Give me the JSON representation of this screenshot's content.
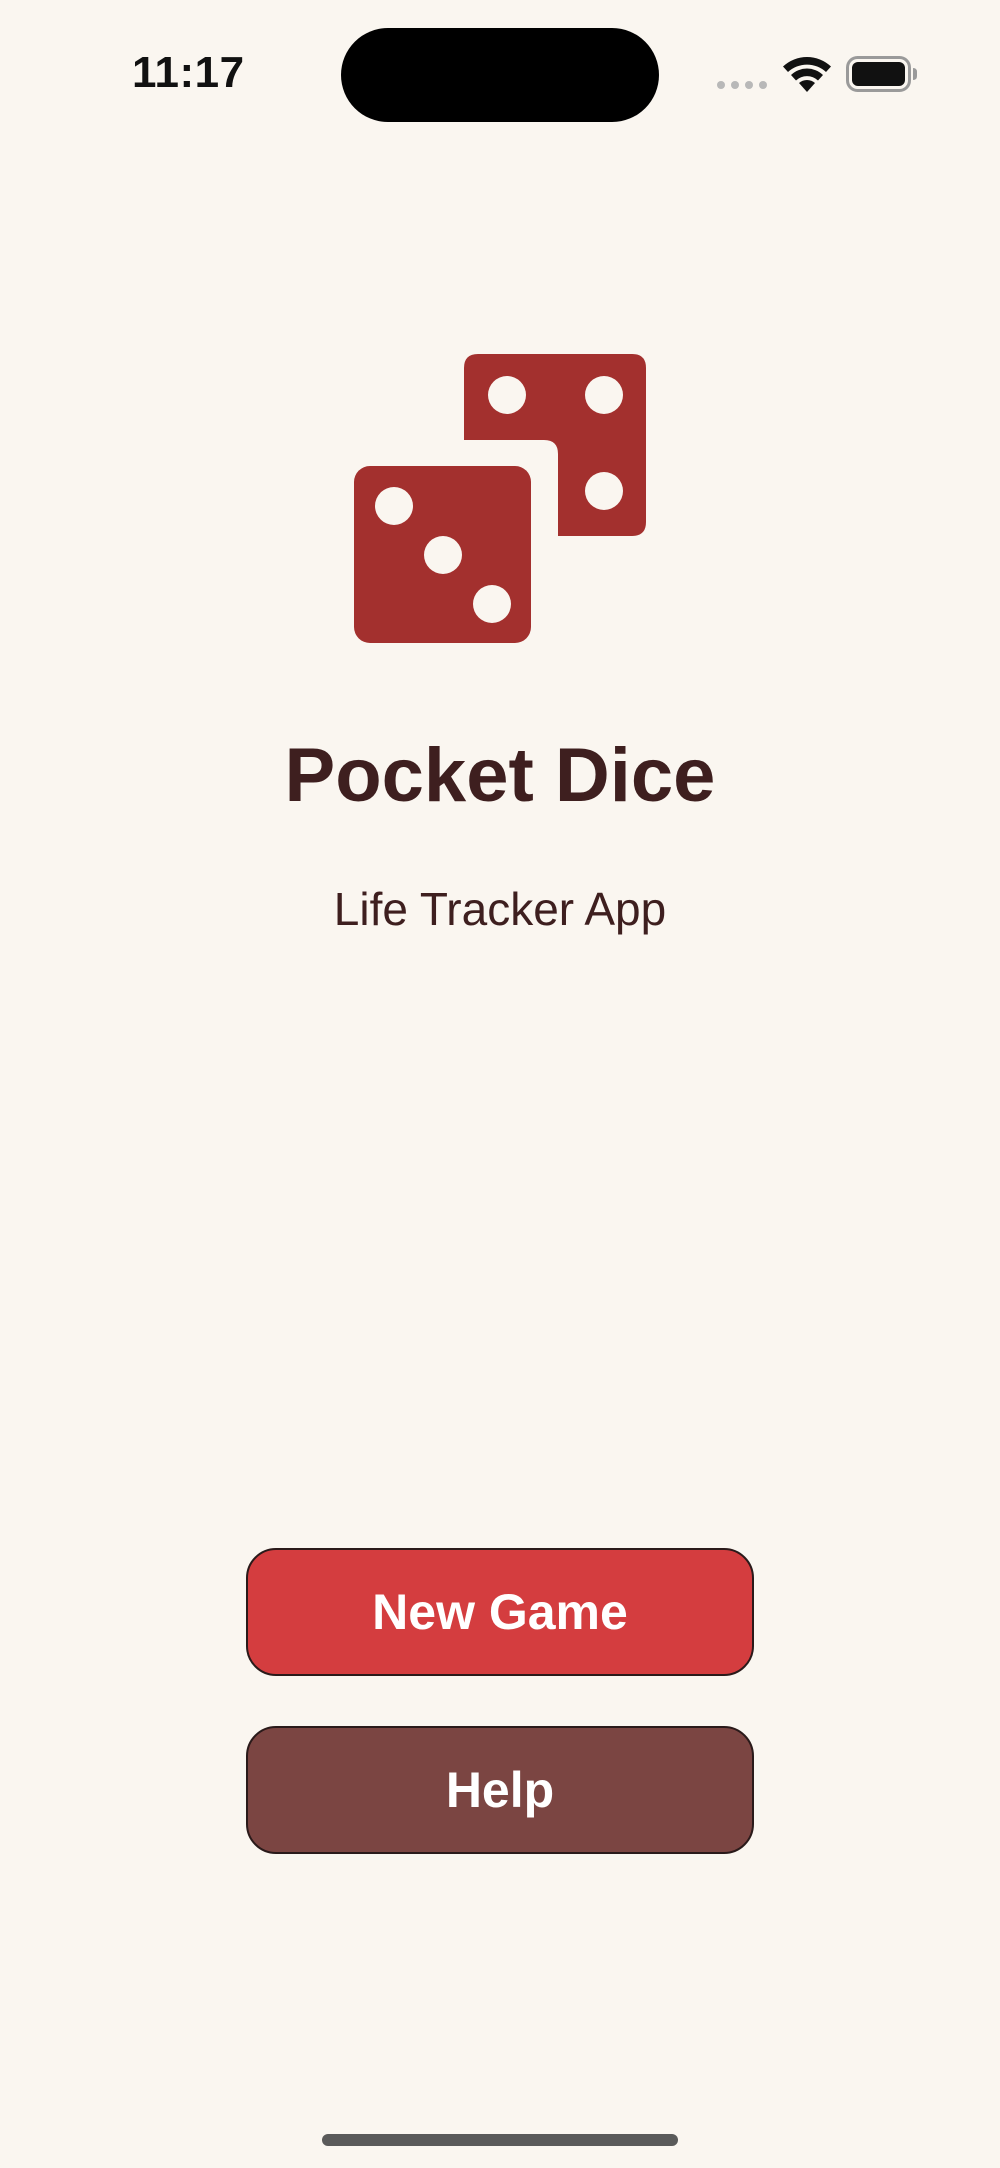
{
  "status_bar": {
    "time": "11:17",
    "icons": [
      "signal-dots-icon",
      "wifi-icon",
      "battery-icon"
    ]
  },
  "app": {
    "logo_icon": "dice-icon",
    "title": "Pocket Dice",
    "subtitle": "Life Tracker App"
  },
  "actions": {
    "new_game_label": "New Game",
    "help_label": "Help"
  },
  "colors": {
    "background": "#faf6f0",
    "dice": "#a3302e",
    "title_text": "#3e1f1f",
    "new_game_button": "#d43d3f",
    "help_button": "#7b4542"
  }
}
